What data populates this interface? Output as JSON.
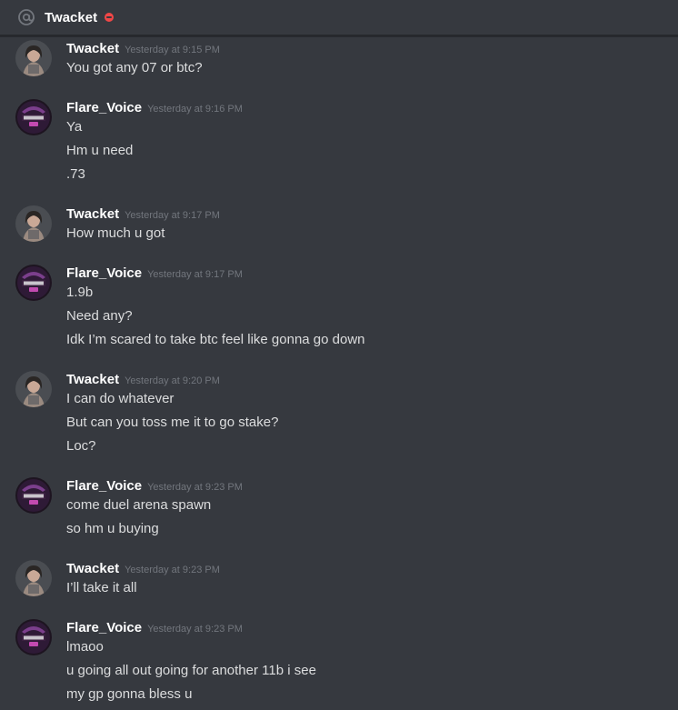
{
  "header": {
    "title": "Twacket",
    "at_icon": "at-icon",
    "status": "do-not-disturb",
    "status_color": "#f04747"
  },
  "colors": {
    "background": "#36393f",
    "author": "#ffffff",
    "timestamp": "#72767d",
    "text": "#dcddde"
  },
  "messages": [
    {
      "author": "Twacket",
      "time": "Yesterday at 9:15 PM",
      "avatar": "twacket-avatar",
      "lines": [
        "You got any 07 or btc?"
      ]
    },
    {
      "author": "Flare_Voice",
      "time": "Yesterday at 9:16 PM",
      "avatar": "flare-voice-avatar",
      "lines": [
        "Ya",
        "Hm u need",
        ".73"
      ]
    },
    {
      "author": "Twacket",
      "time": "Yesterday at 9:17 PM",
      "avatar": "twacket-avatar",
      "lines": [
        "How much u got"
      ]
    },
    {
      "author": "Flare_Voice",
      "time": "Yesterday at 9:17 PM",
      "avatar": "flare-voice-avatar",
      "lines": [
        "1.9b",
        "Need any?",
        "Idk I’m scared to take btc feel like gonna go down"
      ]
    },
    {
      "author": "Twacket",
      "time": "Yesterday at 9:20 PM",
      "avatar": "twacket-avatar",
      "lines": [
        "I can do whatever",
        "But can you toss me it to go stake?",
        "Loc?"
      ]
    },
    {
      "author": "Flare_Voice",
      "time": "Yesterday at 9:23 PM",
      "avatar": "flare-voice-avatar",
      "lines": [
        "come duel arena spawn",
        "so hm u buying"
      ]
    },
    {
      "author": "Twacket",
      "time": "Yesterday at 9:23 PM",
      "avatar": "twacket-avatar",
      "lines": [
        "I’ll take it all"
      ]
    },
    {
      "author": "Flare_Voice",
      "time": "Yesterday at 9:23 PM",
      "avatar": "flare-voice-avatar",
      "lines": [
        "lmaoo",
        "u going all out going for another 11b i see",
        "my gp gonna bless u"
      ]
    }
  ]
}
